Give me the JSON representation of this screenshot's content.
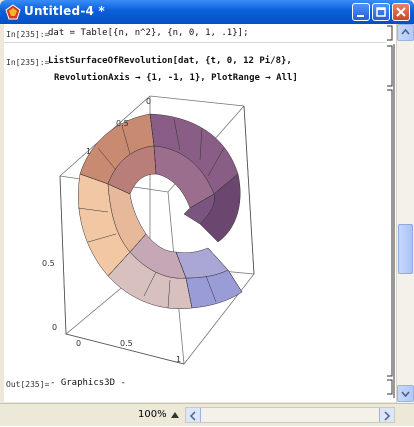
{
  "window": {
    "title": "Untitled-4 *",
    "controls": {
      "minimize": "minimize-icon",
      "maximize": "maximize-icon",
      "close": "close-icon"
    }
  },
  "cells": {
    "in1": {
      "label": "In[235]:=",
      "code": "dat = Table[{n, n^2}, {n, 0, 1, .1}];"
    },
    "in2": {
      "label": "In[235]:=",
      "line1": "ListSurfaceOfRevolution[dat, {t, 0, 12 Pi/8},",
      "line2": "RevolutionAxis → {1, -1, 1}, PlotRange → All]"
    },
    "out": {
      "label": "Out[235]=",
      "value": "- Graphics3D -"
    }
  },
  "plot": {
    "tick_top_0": "0",
    "tick_top_05": "0.5",
    "tick_left_1": "1",
    "tick_left_05": "0.5",
    "tick_left_0": "0",
    "tick_bottom_0": "0",
    "tick_bottom_05": "0.5",
    "tick_bottom_1": "1"
  },
  "status": {
    "zoom": "100%"
  }
}
